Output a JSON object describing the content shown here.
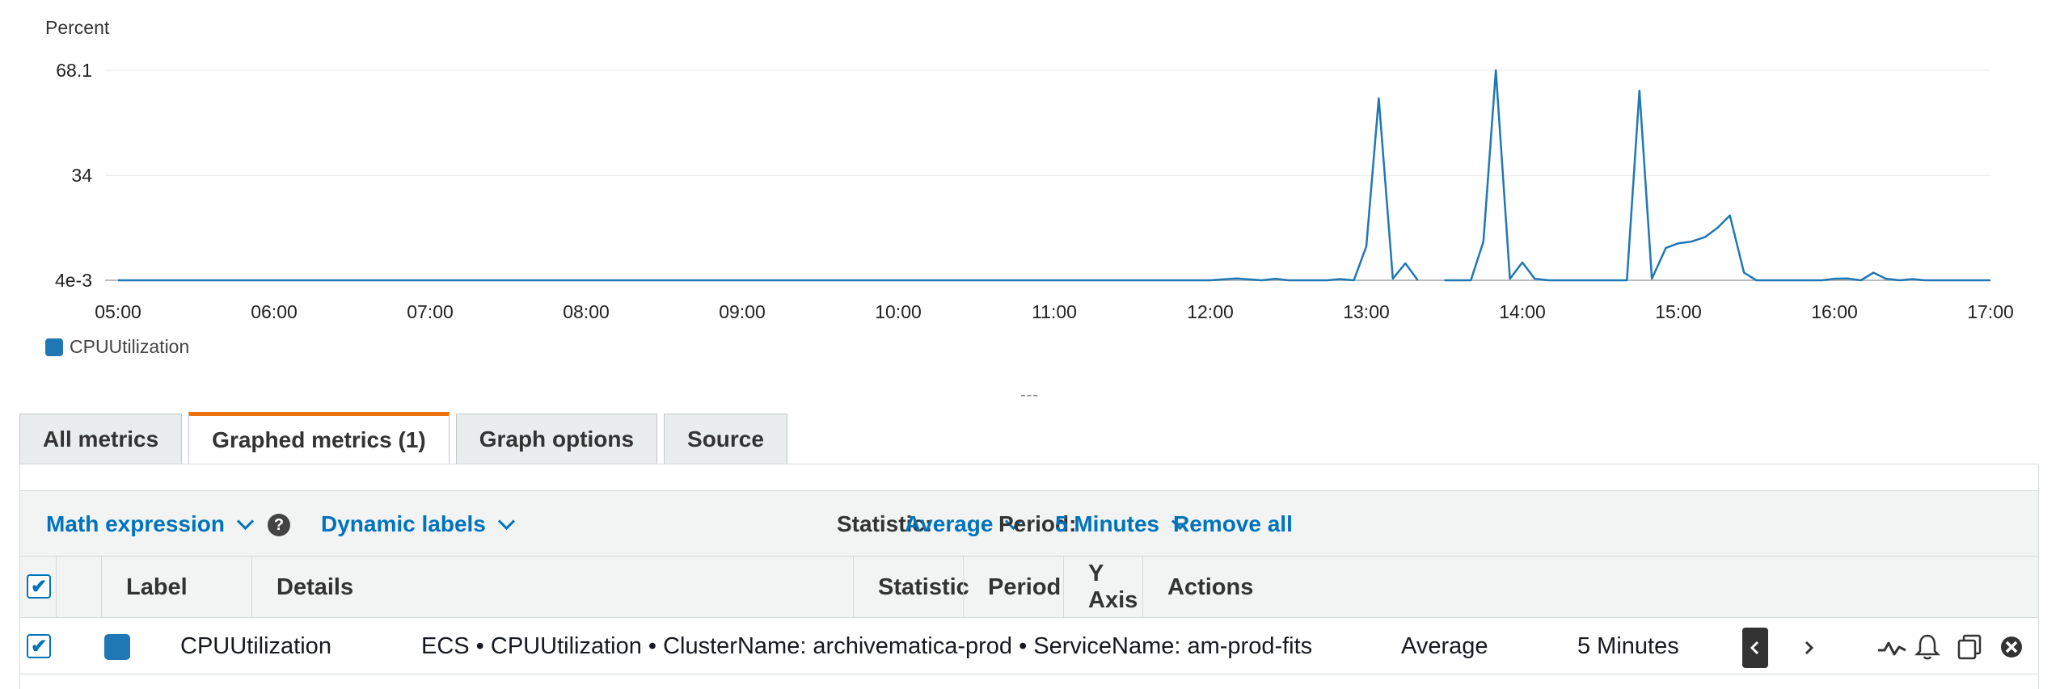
{
  "chart_data": {
    "type": "line",
    "ylabel": "Percent",
    "y_ticks": [
      "68.1",
      "34",
      "4e-3"
    ],
    "y_tick_values": [
      68.1,
      34,
      0.004
    ],
    "ylim": [
      0.004,
      68.1
    ],
    "x_ticks": [
      "05:00",
      "06:00",
      "07:00",
      "08:00",
      "09:00",
      "10:00",
      "11:00",
      "12:00",
      "13:00",
      "14:00",
      "15:00",
      "16:00",
      "17:00"
    ],
    "xlim_hours": [
      5,
      17
    ],
    "grid": true,
    "legend_position": "bottom-left",
    "series": [
      {
        "name": "CPUUtilization",
        "color": "#1f77b4",
        "points": [
          [
            5.0,
            0.004
          ],
          [
            12.0,
            0.004
          ],
          [
            12.17,
            0.6
          ],
          [
            12.33,
            0.004
          ],
          [
            12.42,
            0.5
          ],
          [
            12.5,
            0.004
          ],
          [
            12.75,
            0.004
          ],
          [
            12.83,
            0.4
          ],
          [
            12.92,
            0.004
          ],
          [
            13.0,
            11
          ],
          [
            13.08,
            59
          ],
          [
            13.17,
            0.5
          ],
          [
            13.25,
            5.5
          ],
          [
            13.33,
            0.004
          ],
          [
            null,
            null
          ],
          [
            13.5,
            0.004
          ],
          [
            13.67,
            0.004
          ],
          [
            13.75,
            12.5
          ],
          [
            13.83,
            68.1
          ],
          [
            13.92,
            0.5
          ],
          [
            14.0,
            5.8
          ],
          [
            14.08,
            0.5
          ],
          [
            14.17,
            0.004
          ],
          [
            14.67,
            0.004
          ],
          [
            14.75,
            61.5
          ],
          [
            14.83,
            0.5
          ],
          [
            14.92,
            10.5
          ],
          [
            15.0,
            12
          ],
          [
            15.08,
            12.5
          ],
          [
            15.17,
            14
          ],
          [
            15.25,
            17
          ],
          [
            15.33,
            21
          ],
          [
            15.42,
            2.5
          ],
          [
            15.5,
            0.004
          ],
          [
            15.92,
            0.004
          ],
          [
            16.0,
            0.5
          ],
          [
            16.08,
            0.6
          ],
          [
            16.17,
            0.004
          ],
          [
            16.25,
            2.5
          ],
          [
            16.33,
            0.5
          ],
          [
            16.42,
            0.004
          ],
          [
            16.5,
            0.4
          ],
          [
            16.58,
            0.004
          ],
          [
            17.0,
            0.004
          ]
        ]
      }
    ]
  },
  "legend": {
    "label": "CPUUtilization",
    "color": "#1f77b4"
  },
  "resize_handle": "---",
  "tabs": [
    {
      "label": "All metrics",
      "active": false
    },
    {
      "label": "Graphed metrics (1)",
      "active": true
    },
    {
      "label": "Graph options",
      "active": false
    },
    {
      "label": "Source",
      "active": false
    }
  ],
  "toolbar": {
    "math_expression": "Math expression",
    "help_glyph": "?",
    "dynamic_labels": "Dynamic labels",
    "statistic_label": "Statistic:",
    "statistic_value": "Average",
    "period_label": "Period:",
    "period_value": "5 Minutes",
    "remove_all": "Remove all"
  },
  "table": {
    "columns": [
      "Label",
      "Details",
      "Statistic",
      "Period",
      "Y Axis",
      "Actions"
    ],
    "rows": [
      {
        "checked": true,
        "color": "#1f77b4",
        "label": "CPUUtilization",
        "details": "ECS • CPUUtilization • ClusterName: archivematica-prod • ServiceName: am-prod-fits",
        "statistic": "Average",
        "period": "5 Minutes"
      }
    ]
  },
  "icons": {
    "header_checkbox": "checkbox-checked-icon",
    "y_axis_left": "chevron-left-icon",
    "y_axis_right": "chevron-right-icon",
    "actions": [
      "graph-line-icon",
      "bell-icon",
      "duplicate-icon",
      "remove-icon"
    ]
  }
}
